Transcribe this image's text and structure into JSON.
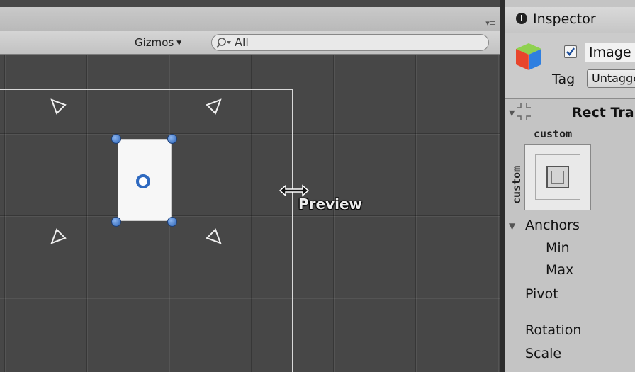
{
  "scene": {
    "toolbar": {
      "gizmos_label": "Gizmos",
      "gizmos_caret": "▼",
      "search_value": "All",
      "search_icon": "search-icon",
      "panel_menu": "▾≡"
    },
    "viewport": {
      "preview_label": "Preview",
      "selected_element": "image-rect",
      "resize_cursor": "horizontal-resize-icon"
    }
  },
  "inspector": {
    "title": "Inspector",
    "info_icon": "i",
    "gameobject": {
      "active": true,
      "name": "Image",
      "tag_label": "Tag",
      "tag_value": "Untagged"
    },
    "rect_transform": {
      "title": "Rect Transform",
      "anchor_preset_horizontal": "custom",
      "anchor_preset_vertical": "custom",
      "anchors_label": "Anchors",
      "min_label": "Min",
      "max_label": "Max",
      "pivot_label": "Pivot",
      "rotation_label": "Rotation",
      "scale_label": "Scale"
    }
  },
  "colors": {
    "scene_background": "#474747",
    "inspector_background": "#c4c4c4",
    "handle_blue": "#2b62b5",
    "canvas_outline": "#d9d9d9"
  }
}
